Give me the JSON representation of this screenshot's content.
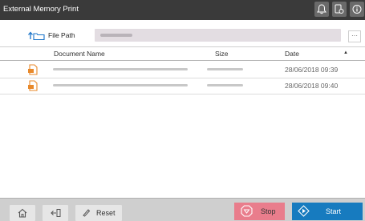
{
  "window": {
    "title": "External Memory Print"
  },
  "titlebar": {
    "icons": [
      "bell-icon",
      "phone-settings-icon",
      "info-icon"
    ]
  },
  "file_path": {
    "label": "File Path",
    "value_redacted": true,
    "more_label": "···"
  },
  "table": {
    "columns": {
      "name": "Document Name",
      "size": "Size",
      "date": "Date",
      "sort_indicator": "▲"
    },
    "rows": [
      {
        "icon": "pdf-document-icon",
        "name_redacted": true,
        "size_redacted": true,
        "date": "28/06/2018 09:39"
      },
      {
        "icon": "pdf-document-icon",
        "name_redacted": true,
        "size_redacted": true,
        "date": "28/06/2018 09:40"
      }
    ]
  },
  "bottombar": {
    "home_icon": "home-icon",
    "back_icon": "back-exit-icon",
    "reset_label": "Reset",
    "stop_label": "Stop",
    "start_label": "Start"
  },
  "colors": {
    "titlebar": "#3a3a3a",
    "stop": "#e97d8c",
    "start": "#177bbf",
    "document_icon": "#e8892b",
    "folder_icon": "#1b74c9"
  }
}
